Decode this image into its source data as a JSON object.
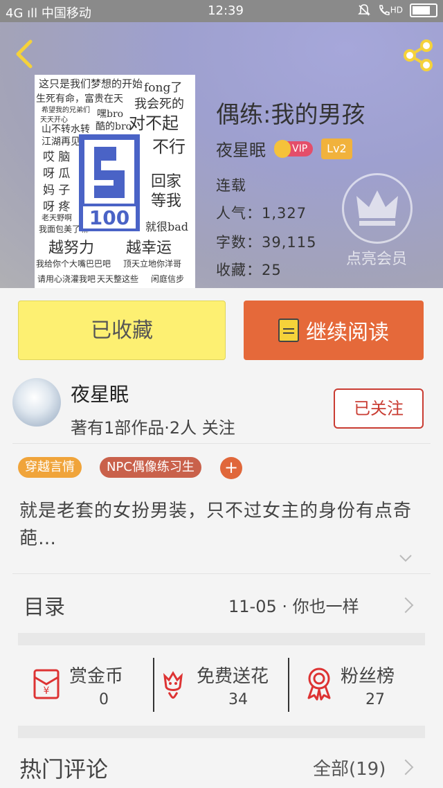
{
  "status_bar": {
    "carrier": "4G ıll 中国移动",
    "time": "12:39",
    "right_icons": [
      "bell-off-icon",
      "call-hd-icon",
      "battery-icon"
    ],
    "hd_label": "HD",
    "battery_level": 0.9
  },
  "book": {
    "title": "偶练:我的男孩",
    "author": "夜星眠",
    "vip_label": "VIP",
    "level": "Lv2",
    "status": "连载",
    "popularity_line": "人气：1,327",
    "word_count_line": "字数：39,115",
    "favorites_line": "收藏：25",
    "light_vip_label": "点亮会员"
  },
  "cover": {
    "badge_text": "100",
    "lines": [
      "这只是我们梦想的开始",
      "fong了",
      "生死有命，富贵在天",
      "我会死的",
      "希望我的兄弟们",
      "嘿bro",
      "天天开心",
      "对不起",
      "山不转水转",
      "酷的bro",
      "不行",
      "江湖再见",
      "哎 脑",
      "呀 瓜",
      "回家",
      "妈 子",
      "等我",
      "呀 疼",
      "老天野啊",
      "就很bad",
      "我面包美了嘛",
      "越努力",
      "越幸运",
      "我给你个大嘴巴巴吧",
      "顶天立地你洋哥",
      "请用心浇灌我吧",
      "天天整这些",
      "闲庭信步"
    ]
  },
  "actions": {
    "collected_label": "已收藏",
    "continue_label": "继续阅读"
  },
  "author_card": {
    "name": "夜星眠",
    "meta": "著有1部作品·2人 关注",
    "follow_label": "已关注"
  },
  "tags": [
    {
      "label": "穿越言情",
      "color": "#f0a43a"
    },
    {
      "label": "NPC偶像练习生",
      "color": "#c9614b"
    }
  ],
  "tag_add_label": "+",
  "synopsis": "就是老套的女扮男装，只不过女主的身份有点奇葩…",
  "toc": {
    "label": "目录",
    "latest": "11-05 · 你也一样"
  },
  "stats": [
    {
      "title": "赏金币",
      "value": "0",
      "icon": "red-envelope-icon"
    },
    {
      "title": "免费送花",
      "value": "34",
      "icon": "flower-icon"
    },
    {
      "title": "粉丝榜",
      "value": "27",
      "icon": "medal-icon"
    }
  ],
  "comments": {
    "label": "热门评论",
    "all_label": "全部(19)"
  }
}
